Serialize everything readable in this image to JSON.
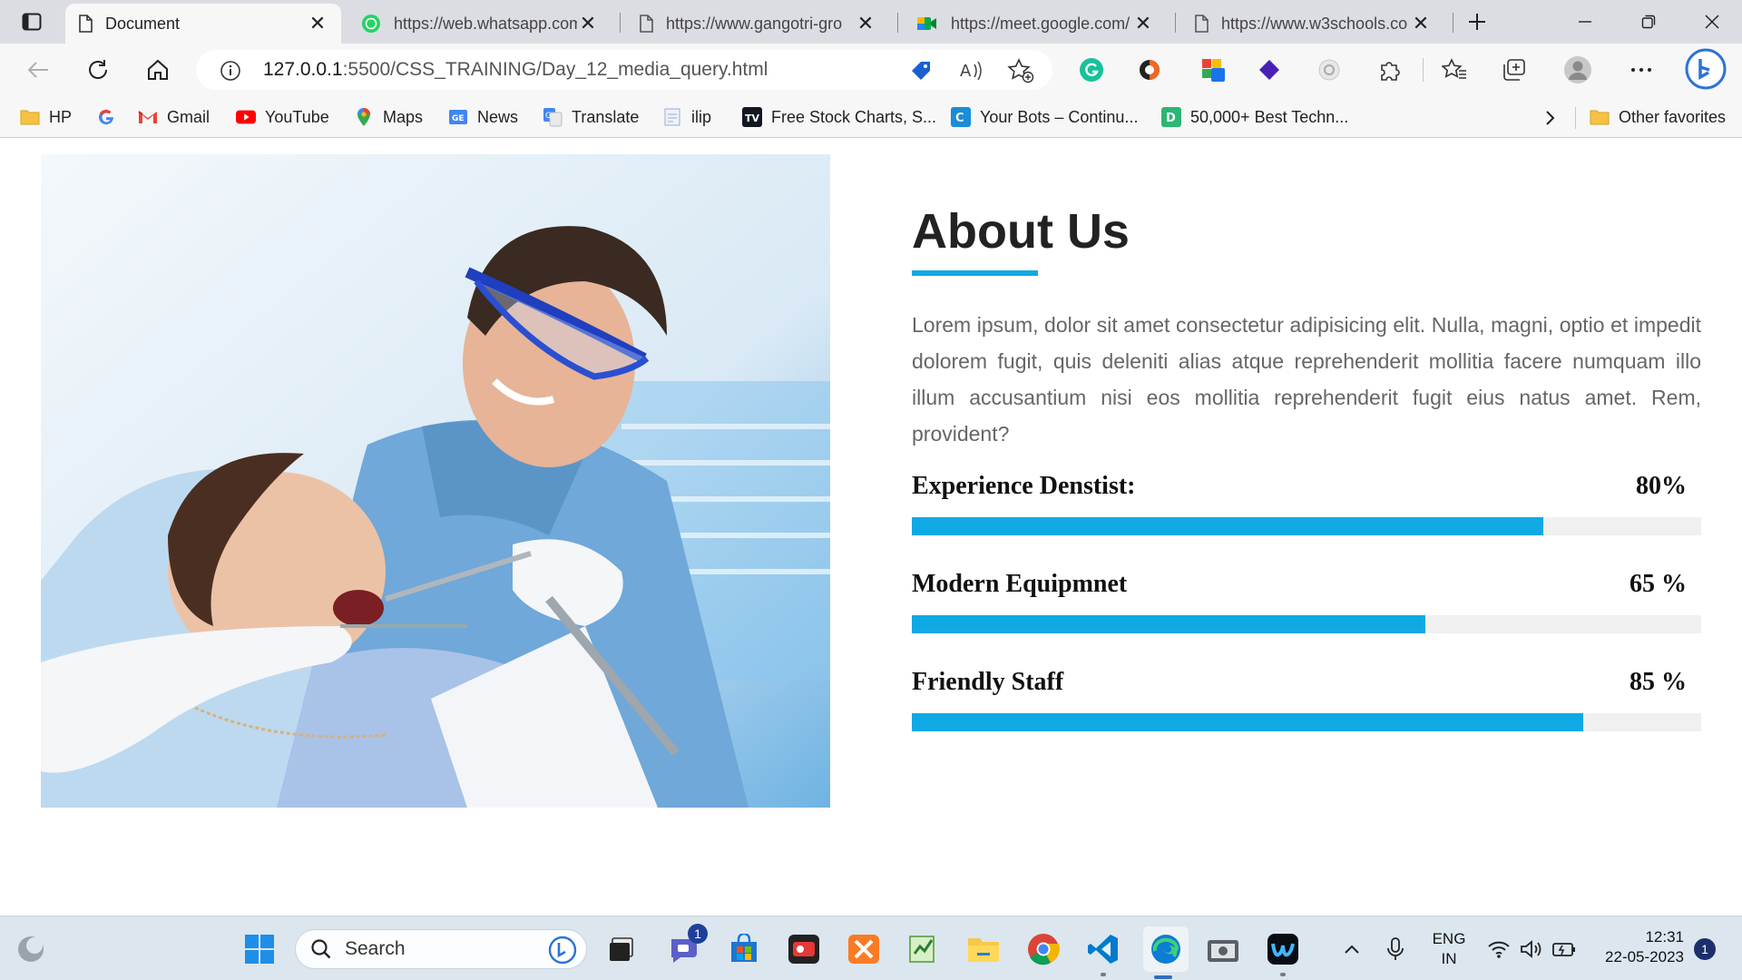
{
  "browser": {
    "tabs": [
      {
        "title": "Document",
        "active": true
      },
      {
        "title": "https://web.whatsapp.com",
        "active": false
      },
      {
        "title": "https://www.gangotri-gro",
        "active": false
      },
      {
        "title": "https://meet.google.com/",
        "active": false
      },
      {
        "title": "https://www.w3schools.co",
        "active": false
      }
    ],
    "address": {
      "host": "127.0.0.1",
      "path": ":5500/CSS_TRAINING/Day_12_media_query.html"
    },
    "favorites": [
      "HP",
      "Gmail",
      "YouTube",
      "Maps",
      "News",
      "Translate",
      "ilip",
      "Free Stock Charts, S...",
      "Your Bots – Continu...",
      "50,000+ Best Techn..."
    ],
    "other_favorites": "Other favorites"
  },
  "page": {
    "title": "About Us",
    "text": "Lorem ipsum, dolor sit amet consectetur adipisicing elit. Nulla, magni, optio et impedit dolorem fugit, quis deleniti alias atque reprehenderit mollitia facere numquam illo illum accusantium nisi eos mollitia reprehenderit fugit eius natus amet. Rem, provident?",
    "skills": [
      {
        "label": "Experience Denstist:",
        "percent_text": "80%",
        "value": 80
      },
      {
        "label": "Modern Equipmnet",
        "percent_text": "65 %",
        "value": 65
      },
      {
        "label": "Friendly Staff",
        "percent_text": "85 %",
        "value": 85
      }
    ],
    "accent_color": "#10a9e4"
  },
  "taskbar": {
    "search_label": "Search",
    "teams_badge": "1",
    "lang_line1": "ENG",
    "lang_line2": "IN",
    "time": "12:31",
    "date": "22-05-2023",
    "notification_count": "1"
  }
}
